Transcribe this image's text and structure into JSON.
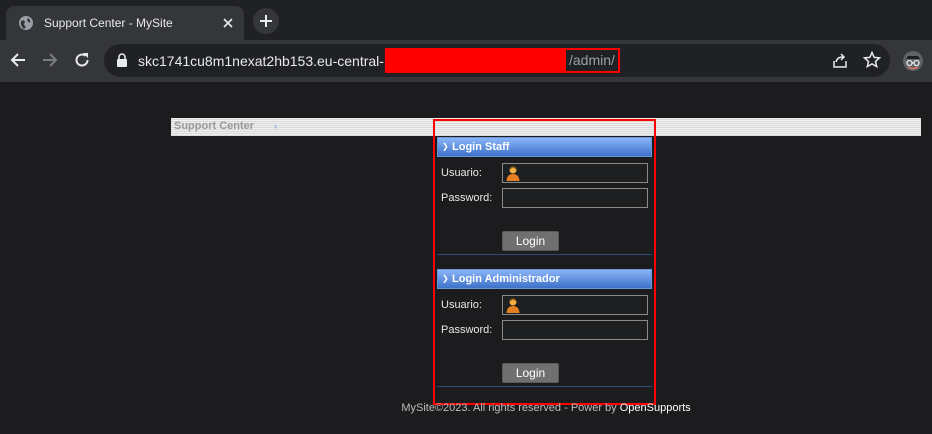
{
  "browser": {
    "tab_title": "Support Center - MySite",
    "new_tab_symbol": "+",
    "url_host": "skc1741cu8m1nexat2hb153.eu-central-1",
    "url_path": "/admin/"
  },
  "page": {
    "header_title": "Support Center",
    "header_arrow": "›",
    "staff": {
      "title": "Login Staff",
      "usuario_label": "Usuario:",
      "password_label": "Password:",
      "login_button": "Login"
    },
    "admin": {
      "title": "Login Administrador",
      "usuario_label": "Usuario:",
      "password_label": "Password:",
      "login_button": "Login"
    },
    "footer_text": "MySite©2023. All rights reserved - Power by ",
    "footer_link": "OpenSupports"
  },
  "colors": {
    "redaction": "#ff0000",
    "highlight_border": "#ff0000",
    "section_header": "#3d72c9"
  }
}
